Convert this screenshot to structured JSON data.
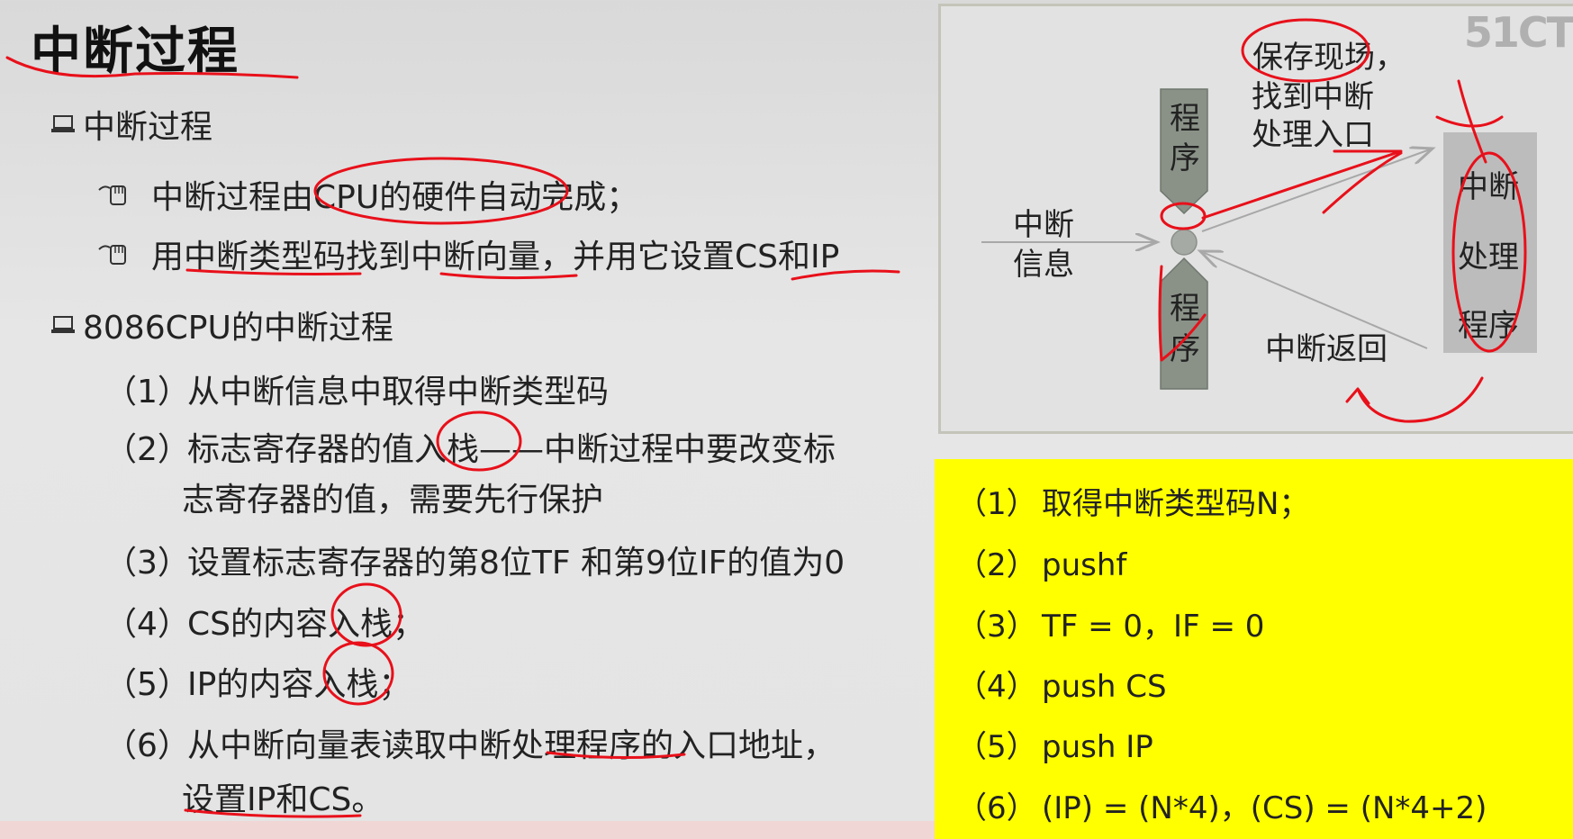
{
  "slide": {
    "title": "中断过程",
    "section1": {
      "heading": "中断过程",
      "items": [
        "中断过程由CPU的硬件自动完成；",
        "用中断类型码找到中断向量，并用它设置CS和IP"
      ]
    },
    "section2": {
      "heading": "8086CPU的中断过程",
      "steps": [
        {
          "num": "（1）",
          "text": "从中断信息中取得中断类型码"
        },
        {
          "num": "（2）",
          "text": "标志寄存器的值入栈——中断过程中要改变标",
          "cont": "志寄存器的值，需要先行保护"
        },
        {
          "num": "（3）",
          "text": "设置标志寄存器的第8位TF 和第9位IF的值为0"
        },
        {
          "num": "（4）",
          "text": "CS的内容入栈；"
        },
        {
          "num": "（5）",
          "text": "IP的内容入栈；"
        },
        {
          "num": "（6）",
          "text": "从中断向量表读取中断处理程序的入口地址，",
          "cont": "设置IP和CS。"
        }
      ]
    }
  },
  "diagram": {
    "watermark": "51CT",
    "save_context": "保存现场，",
    "find_entry_1": "找到中断",
    "find_entry_2": "处理入口",
    "program_top": [
      "程",
      "序"
    ],
    "program_bottom": [
      "程",
      "序"
    ],
    "interrupt_info_1": "中断",
    "interrupt_info_2": "信息",
    "handler": [
      "中断",
      "处理",
      "程序"
    ],
    "interrupt_return": "中断返回"
  },
  "code": {
    "lines": [
      {
        "num": "（1）",
        "text": "取得中断类型码N；"
      },
      {
        "num": "（2）",
        "text": "pushf"
      },
      {
        "num": "（3）",
        "text": "TF = 0，IF = 0"
      },
      {
        "num": "（4）",
        "text": "push CS"
      },
      {
        "num": "（5）",
        "text": "push IP"
      },
      {
        "num": "（6）",
        "text": "(IP) = (N*4)，(CS) = (N*4+2)"
      }
    ]
  },
  "colors": {
    "highlight": "#ffff00",
    "annotation": "#e8101a",
    "arrow": "#a8a8a8",
    "program_box": "#8a9288"
  },
  "icons": [
    "laptop-icon",
    "hand-pointer-icon"
  ]
}
